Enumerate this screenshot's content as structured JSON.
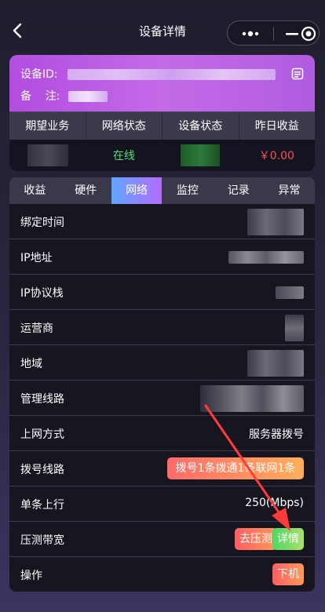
{
  "header": {
    "title": "设备详情",
    "back_icon": "back-chevron-icon",
    "capsule_icons": [
      "more-dots-icon",
      "minimize-icon",
      "target-icon"
    ]
  },
  "device_card": {
    "id_label": "设备ID:",
    "note_label": "备    注:",
    "copy_icon": "document-icon",
    "columns": [
      "期望业务",
      "网络状态",
      "设备状态",
      "昨日收益"
    ],
    "network_status": "在线",
    "yesterday_income": "￥0.00"
  },
  "tabs": [
    "收益",
    "硬件",
    "网络",
    "监控",
    "记录",
    "异常"
  ],
  "active_tab": "网络",
  "rows": {
    "bind_time": "绑定时间",
    "ip": "IP地址",
    "ip_stack": "IP协议栈",
    "carrier": "运营商",
    "region": "地域",
    "mgmt_line": "管理线路",
    "access_mode": "上网方式",
    "access_mode_value": "服务器拨号",
    "dial_line": "拨号线路",
    "dial_line_value": "拨号1条拨通1条联网1条",
    "uplink": "单条上行",
    "uplink_value": "250(Mbps)",
    "stress_bw": "压测带宽",
    "stress_btn": "去压测",
    "detail_btn": "详情",
    "ops": "操作",
    "offline_btn": "下机"
  },
  "colors": {
    "accent_purple": "#b24de0",
    "online_green": "#4ee07a",
    "money_red": "#ff4d5a",
    "arrow_red": "#ff3b3b"
  }
}
